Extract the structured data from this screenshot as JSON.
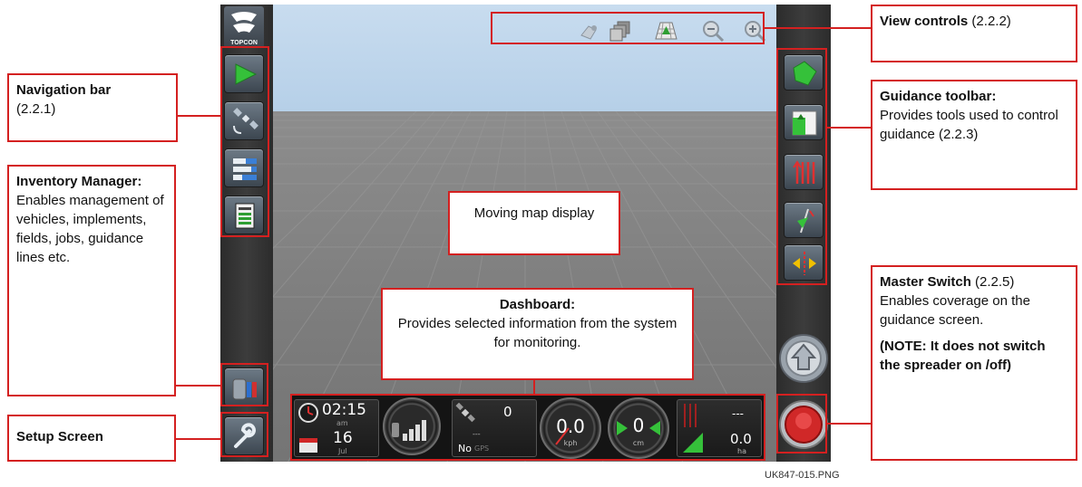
{
  "brand": {
    "logo_text": "TOPCON"
  },
  "annotations": {
    "view_controls": {
      "title": "View controls",
      "ref": " (2.2.2)"
    },
    "navigation_bar": {
      "title": "Navigation bar",
      "ref": "(2.2.1)"
    },
    "inventory_manager": {
      "title": "Inventory Manager:",
      "body": "Enables management of vehicles, implements, fields, jobs, guidance lines etc."
    },
    "setup_screen": {
      "title": "Setup Screen"
    },
    "guidance_toolbar": {
      "title": "Guidance toolbar:",
      "body": "Provides tools used to control guidance (2.2.3)"
    },
    "moving_map": {
      "body": "Moving map display"
    },
    "dashboard": {
      "title": "Dashboard:",
      "body": "Provides selected information from the system for monitoring."
    },
    "master_switch": {
      "title": "Master Switch",
      "ref": " (2.2.5)",
      "body": "Enables coverage on the guidance screen.",
      "note": "(NOTE: It does not switch the spreader on /off)"
    }
  },
  "dashboard": {
    "time": "02:15",
    "time_suffix": "am",
    "date": "16",
    "month": "Jul",
    "satellites": "0",
    "gps_dashes": "---",
    "gps_status": "No",
    "gps_label": "GPS",
    "speed": "0.0",
    "speed_unit": "kph",
    "offline": "0",
    "offline_unit": "cm",
    "area_top": "---",
    "area": "0.0",
    "area_unit": "ha"
  },
  "caption": "UK847-015.PNG",
  "colors": {
    "accent": "#d42020",
    "guidance_green": "#35c13a"
  }
}
